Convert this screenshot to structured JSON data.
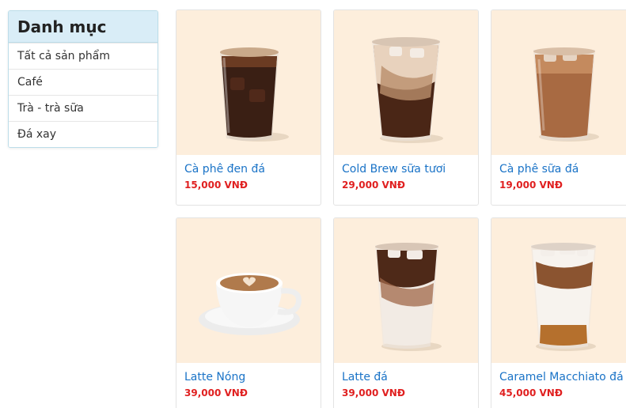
{
  "sidebar": {
    "title": "Danh mục",
    "items": [
      {
        "label": "Tất cả sản phẩm"
      },
      {
        "label": "Café"
      },
      {
        "label": "Trà - trà sữa"
      },
      {
        "label": "Đá xay"
      }
    ]
  },
  "products": [
    {
      "name": "Cà phê đen đá",
      "price": "15,000 VNĐ",
      "icon": "iced-black-coffee-image"
    },
    {
      "name": "Cold Brew sữa tươi",
      "price": "29,000 VNĐ",
      "icon": "cold-brew-milk-image"
    },
    {
      "name": "Cà phê sữa đá",
      "price": "19,000 VNĐ",
      "icon": "iced-milk-coffee-image"
    },
    {
      "name": "Latte Nóng",
      "price": "39,000 VNĐ",
      "icon": "hot-latte-cup-image"
    },
    {
      "name": "Latte đá",
      "price": "39,000 VNĐ",
      "icon": "iced-latte-image"
    },
    {
      "name": "Caramel Macchiato đá",
      "price": "45,000 VNĐ",
      "icon": "iced-caramel-macchiato-image"
    }
  ],
  "colors": {
    "accent_link": "#1a73c7",
    "price": "#e02020",
    "sidebar_header": "#d9edf7",
    "image_bg": "#fdeedc"
  }
}
